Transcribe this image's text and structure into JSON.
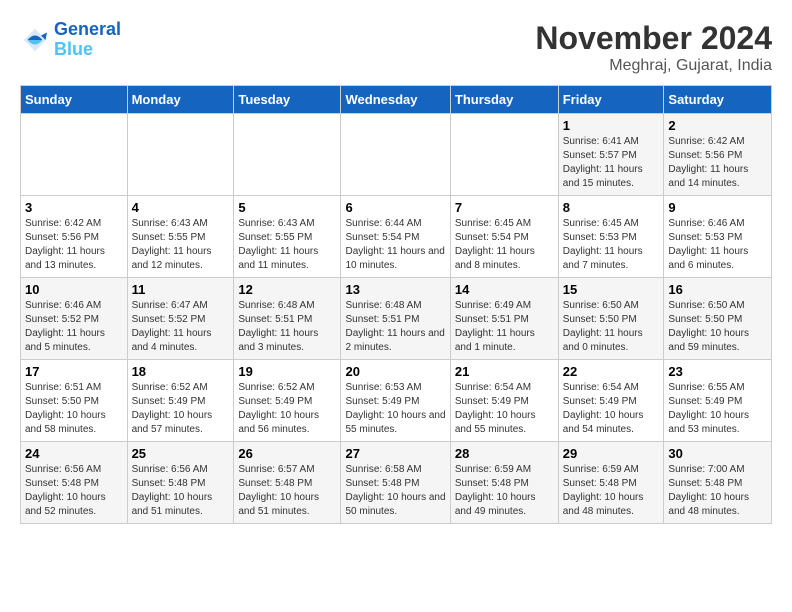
{
  "logo": {
    "line1": "General",
    "line2": "Blue"
  },
  "title": "November 2024",
  "location": "Meghraj, Gujarat, India",
  "weekdays": [
    "Sunday",
    "Monday",
    "Tuesday",
    "Wednesday",
    "Thursday",
    "Friday",
    "Saturday"
  ],
  "weeks": [
    [
      {
        "day": "",
        "info": ""
      },
      {
        "day": "",
        "info": ""
      },
      {
        "day": "",
        "info": ""
      },
      {
        "day": "",
        "info": ""
      },
      {
        "day": "",
        "info": ""
      },
      {
        "day": "1",
        "info": "Sunrise: 6:41 AM\nSunset: 5:57 PM\nDaylight: 11 hours and 15 minutes."
      },
      {
        "day": "2",
        "info": "Sunrise: 6:42 AM\nSunset: 5:56 PM\nDaylight: 11 hours and 14 minutes."
      }
    ],
    [
      {
        "day": "3",
        "info": "Sunrise: 6:42 AM\nSunset: 5:56 PM\nDaylight: 11 hours and 13 minutes."
      },
      {
        "day": "4",
        "info": "Sunrise: 6:43 AM\nSunset: 5:55 PM\nDaylight: 11 hours and 12 minutes."
      },
      {
        "day": "5",
        "info": "Sunrise: 6:43 AM\nSunset: 5:55 PM\nDaylight: 11 hours and 11 minutes."
      },
      {
        "day": "6",
        "info": "Sunrise: 6:44 AM\nSunset: 5:54 PM\nDaylight: 11 hours and 10 minutes."
      },
      {
        "day": "7",
        "info": "Sunrise: 6:45 AM\nSunset: 5:54 PM\nDaylight: 11 hours and 8 minutes."
      },
      {
        "day": "8",
        "info": "Sunrise: 6:45 AM\nSunset: 5:53 PM\nDaylight: 11 hours and 7 minutes."
      },
      {
        "day": "9",
        "info": "Sunrise: 6:46 AM\nSunset: 5:53 PM\nDaylight: 11 hours and 6 minutes."
      }
    ],
    [
      {
        "day": "10",
        "info": "Sunrise: 6:46 AM\nSunset: 5:52 PM\nDaylight: 11 hours and 5 minutes."
      },
      {
        "day": "11",
        "info": "Sunrise: 6:47 AM\nSunset: 5:52 PM\nDaylight: 11 hours and 4 minutes."
      },
      {
        "day": "12",
        "info": "Sunrise: 6:48 AM\nSunset: 5:51 PM\nDaylight: 11 hours and 3 minutes."
      },
      {
        "day": "13",
        "info": "Sunrise: 6:48 AM\nSunset: 5:51 PM\nDaylight: 11 hours and 2 minutes."
      },
      {
        "day": "14",
        "info": "Sunrise: 6:49 AM\nSunset: 5:51 PM\nDaylight: 11 hours and 1 minute."
      },
      {
        "day": "15",
        "info": "Sunrise: 6:50 AM\nSunset: 5:50 PM\nDaylight: 11 hours and 0 minutes."
      },
      {
        "day": "16",
        "info": "Sunrise: 6:50 AM\nSunset: 5:50 PM\nDaylight: 10 hours and 59 minutes."
      }
    ],
    [
      {
        "day": "17",
        "info": "Sunrise: 6:51 AM\nSunset: 5:50 PM\nDaylight: 10 hours and 58 minutes."
      },
      {
        "day": "18",
        "info": "Sunrise: 6:52 AM\nSunset: 5:49 PM\nDaylight: 10 hours and 57 minutes."
      },
      {
        "day": "19",
        "info": "Sunrise: 6:52 AM\nSunset: 5:49 PM\nDaylight: 10 hours and 56 minutes."
      },
      {
        "day": "20",
        "info": "Sunrise: 6:53 AM\nSunset: 5:49 PM\nDaylight: 10 hours and 55 minutes."
      },
      {
        "day": "21",
        "info": "Sunrise: 6:54 AM\nSunset: 5:49 PM\nDaylight: 10 hours and 55 minutes."
      },
      {
        "day": "22",
        "info": "Sunrise: 6:54 AM\nSunset: 5:49 PM\nDaylight: 10 hours and 54 minutes."
      },
      {
        "day": "23",
        "info": "Sunrise: 6:55 AM\nSunset: 5:49 PM\nDaylight: 10 hours and 53 minutes."
      }
    ],
    [
      {
        "day": "24",
        "info": "Sunrise: 6:56 AM\nSunset: 5:48 PM\nDaylight: 10 hours and 52 minutes."
      },
      {
        "day": "25",
        "info": "Sunrise: 6:56 AM\nSunset: 5:48 PM\nDaylight: 10 hours and 51 minutes."
      },
      {
        "day": "26",
        "info": "Sunrise: 6:57 AM\nSunset: 5:48 PM\nDaylight: 10 hours and 51 minutes."
      },
      {
        "day": "27",
        "info": "Sunrise: 6:58 AM\nSunset: 5:48 PM\nDaylight: 10 hours and 50 minutes."
      },
      {
        "day": "28",
        "info": "Sunrise: 6:59 AM\nSunset: 5:48 PM\nDaylight: 10 hours and 49 minutes."
      },
      {
        "day": "29",
        "info": "Sunrise: 6:59 AM\nSunset: 5:48 PM\nDaylight: 10 hours and 48 minutes."
      },
      {
        "day": "30",
        "info": "Sunrise: 7:00 AM\nSunset: 5:48 PM\nDaylight: 10 hours and 48 minutes."
      }
    ]
  ]
}
